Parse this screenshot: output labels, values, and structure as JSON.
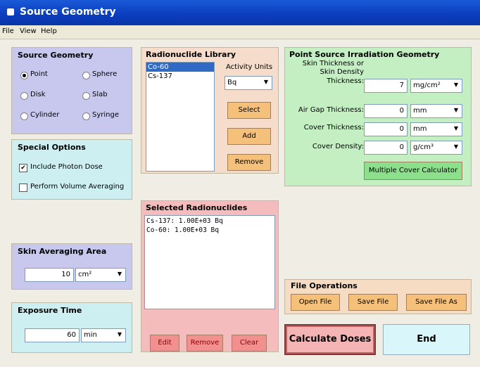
{
  "window": {
    "title": "Source Geometry"
  },
  "menu": [
    "File",
    "View",
    "Help"
  ],
  "source_geometry": {
    "title": "Source Geometry",
    "options": [
      {
        "label": "Point",
        "selected": true
      },
      {
        "label": "Sphere",
        "selected": false
      },
      {
        "label": "Disk",
        "selected": false
      },
      {
        "label": "Slab",
        "selected": false
      },
      {
        "label": "Cylinder",
        "selected": false
      },
      {
        "label": "Syringe",
        "selected": false
      }
    ]
  },
  "special_options": {
    "title": "Special Options",
    "include_photon": {
      "label": "Include Photon Dose",
      "checked": true
    },
    "volume_averaging": {
      "label": "Perform Volume Averaging",
      "checked": false
    }
  },
  "library": {
    "title": "Radionuclide Library",
    "items": [
      "Co-60",
      "Cs-137"
    ],
    "activity_units_label": "Activity Units",
    "activity_units_value": "Bq",
    "select_label": "Select",
    "add_label": "Add",
    "remove_label": "Remove"
  },
  "selected": {
    "title": "Selected Radionuclides",
    "lines": [
      "Cs-137: 1.00E+03 Bq",
      "Co-60:  1.00E+03 Bq"
    ],
    "edit_label": "Edit",
    "remove_label": "Remove",
    "clear_label": "Clear"
  },
  "point_source": {
    "title": "Point Source Irradiation Geometry",
    "skin_label_1": "Skin Thickness or",
    "skin_label_2": "Skin Density",
    "skin_label_3": "Thickness:",
    "skin_value": "7",
    "skin_unit": "mg/cm²",
    "air_label": "Air Gap Thickness:",
    "air_value": "0",
    "air_unit": "mm",
    "cover_label": "Cover Thickness:",
    "cover_value": "0",
    "cover_unit": "mm",
    "density_label": "Cover Density:",
    "density_value": "0",
    "density_unit": "g/cm³",
    "multi_cover_label": "Multiple Cover Calculator"
  },
  "skin_area": {
    "title": "Skin Averaging Area",
    "value": "10",
    "unit": "cm²"
  },
  "exposure": {
    "title": "Exposure Time",
    "value": "60",
    "unit": "min"
  },
  "file_ops": {
    "title": "File Operations",
    "open_label": "Open File",
    "save_label": "Save File",
    "saveas_label": "Save File As"
  },
  "actions": {
    "calculate_label": "Calculate Doses",
    "end_label": "End"
  }
}
